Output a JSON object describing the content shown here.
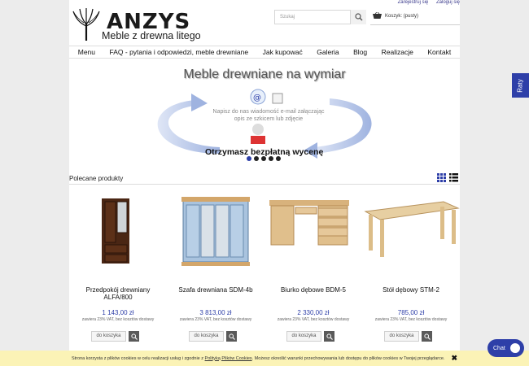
{
  "topbar": {
    "register": "Zarejestruj się",
    "login": "Zaloguj się"
  },
  "logo": {
    "name": "ANZYS",
    "tagline": "Meble z drewna litego"
  },
  "search": {
    "placeholder": "Szukaj"
  },
  "cart": {
    "label": "Koszyk: (pusty)"
  },
  "nav": [
    "Menu",
    "FAQ - pytania i odpowiedzi, meble drewniane",
    "Jak kupować",
    "Galeria",
    "Blog",
    "Realizacje",
    "Kontakt"
  ],
  "banner": {
    "title": "Meble drewniane na wymiar",
    "note": "Napisz do nas wiadomość e-mail załączając opis ze szkicem lub zdjęcie",
    "cta": "Otrzymasz bezpłatną wycenę"
  },
  "section": {
    "title": "Polecane produkty"
  },
  "products": [
    {
      "name": "Przedpokój drewniany ALFA/800",
      "price": "1 143,00 zł",
      "vat": "zawiera 23% VAT, bez kosztów dostawy",
      "add": "do koszyka"
    },
    {
      "name": "Szafa drewniana SDM-4b",
      "price": "3 813,00 zł",
      "vat": "zawiera 23% VAT, bez kosztów dostawy",
      "add": "do koszyka"
    },
    {
      "name": "Biurko dębowe BDM-5",
      "price": "2 330,00 zł",
      "vat": "zawiera 23% VAT, bez kosztów dostawy",
      "add": "do koszyka"
    },
    {
      "name": "Stół dębowy STM-2",
      "price": "785,00 zł",
      "vat": "zawiera 23% VAT, bez kosztów dostawy",
      "add": "do koszyka"
    }
  ],
  "side_tab": {
    "label": "Raty"
  },
  "cookie": {
    "text_before": "Strona korzysta z plików cookies w celu realizacji usług i zgodnie z",
    "link": "Polityką Plików Cookies",
    "text_after": ". Możesz określić warunki przechowywania lub dostępu do plików cookies w Twojej przeglądarce."
  },
  "chat": {
    "label": "Chat"
  },
  "colors": {
    "accent": "#2e3fa8",
    "cookie_bg": "#fbf3b6"
  }
}
